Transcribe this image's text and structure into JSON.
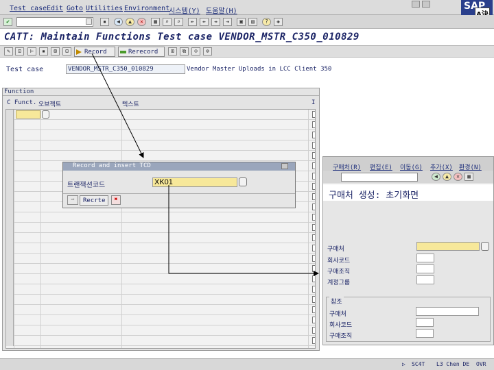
{
  "menubar": {
    "items": [
      "Test case",
      "Edit",
      "Goto",
      "Utilities",
      "Environment",
      "시스템(Y)",
      "도움말(H)"
    ],
    "logo": "SAP",
    "lang_badge": "A決"
  },
  "title": "CATT: Maintain Functions Test case VENDOR_MSTR_C350_010829",
  "appbar": {
    "record_label": "Record",
    "rerecord_label": "Rerecord"
  },
  "test_case": {
    "label": "Test case",
    "value": "VENDOR_MSTR_C350_010829",
    "description": "Vendor Master Uploads in LCC Client 350"
  },
  "functions": {
    "section_label": "Function",
    "columns": [
      "C Funct.",
      "오브젝트",
      "텍스트",
      "I"
    ]
  },
  "popup": {
    "title": "Record and insert TCD",
    "field_label": "트랜잭션코드",
    "field_value": "XK01",
    "record_button": "Recrte"
  },
  "rightwin": {
    "menu": [
      "구매처(R)",
      "편집(E)",
      "이동(G)",
      "추가(X)",
      "환경(N)"
    ],
    "screen_title": "구매처 생성: 초기화면",
    "fields": [
      "구매처",
      "회사코드",
      "구매조직",
      "계정그룹"
    ],
    "reference_section": "참조",
    "ref_fields": [
      "구매처",
      "회사코드",
      "구매조직"
    ]
  },
  "status": {
    "system": "SC4T",
    "info": "L3 Chen DE",
    "mode": "OVR"
  }
}
